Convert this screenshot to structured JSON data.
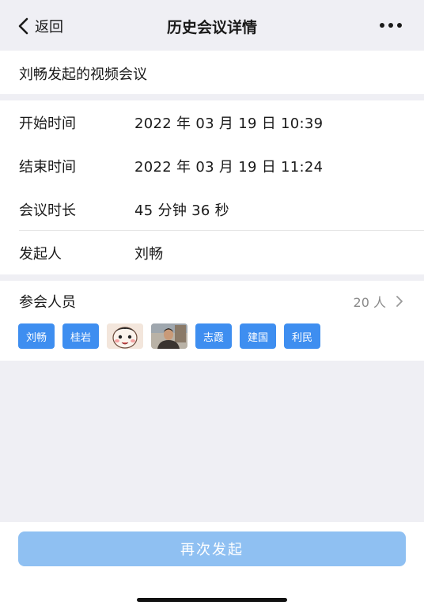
{
  "nav": {
    "back_label": "返回",
    "title": "历史会议详情"
  },
  "meeting": {
    "subject": "刘畅发起的视频会议"
  },
  "info": [
    {
      "label": "开始时间",
      "value": "2022 年 03 月 19 日   10:39"
    },
    {
      "label": "结束时间",
      "value": "2022 年 03 月 19 日   11:24"
    },
    {
      "label": "会议时长",
      "value": "45 分钟 36 秒"
    },
    {
      "label": "发起人",
      "value": "刘畅"
    }
  ],
  "participants": {
    "title": "参会人员",
    "count": "20 人",
    "avatars": [
      {
        "type": "text",
        "name": "刘畅"
      },
      {
        "type": "text",
        "name": "桂岩"
      },
      {
        "type": "image",
        "icon": "cartoon-face-icon"
      },
      {
        "type": "image",
        "icon": "person-photo-icon"
      },
      {
        "type": "text",
        "name": "志霞"
      },
      {
        "type": "text",
        "name": "建国"
      },
      {
        "type": "text",
        "name": "利民"
      }
    ]
  },
  "actions": {
    "restart_label": "再次发起"
  },
  "colors": {
    "accent": "#3e8ef0",
    "button_disabled": "#8fc0f2",
    "background": "#efeff4"
  }
}
